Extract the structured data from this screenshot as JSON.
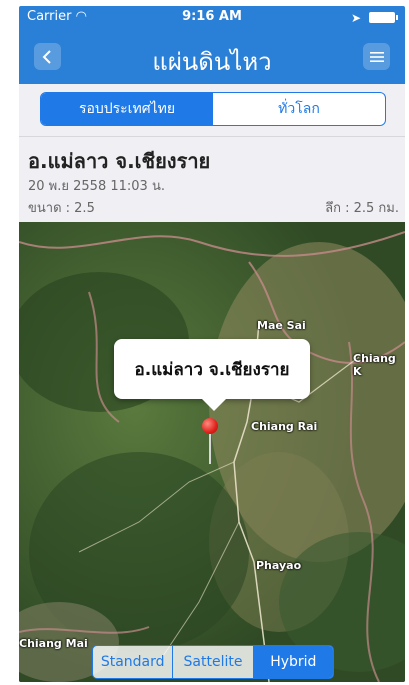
{
  "status_bar": {
    "carrier": "Carrier",
    "time": "9:16 AM"
  },
  "nav": {
    "title": "แผ่นดินไหว",
    "back_icon": "chevron-left-icon",
    "menu_icon": "list-icon"
  },
  "segments": {
    "items": [
      "รอบประเทศไทย",
      "ทั่วโลก"
    ],
    "selected": "รอบประเทศไทย"
  },
  "quake": {
    "title": "อ.แม่ลาว จ.เชียงราย",
    "datetime": "20 พ.ย 2558 11:03 น.",
    "magnitude": "ขนาด : 2.5",
    "depth": "ลึก : 2.5 กม."
  },
  "map": {
    "callout": "อ.แม่ลาว จ.เชียงราย",
    "labels": [
      "Mae Sai",
      "Chiang K",
      "Chiang Rai",
      "Phayao",
      "Chiang Mai"
    ],
    "map_types": [
      "Standard",
      "Sattelite",
      "Hybrid"
    ],
    "selected_type": "Hybrid"
  },
  "colors": {
    "accent": "#1f7ae8",
    "navbar": "#2a7fd6",
    "pin": "#e0201a"
  }
}
